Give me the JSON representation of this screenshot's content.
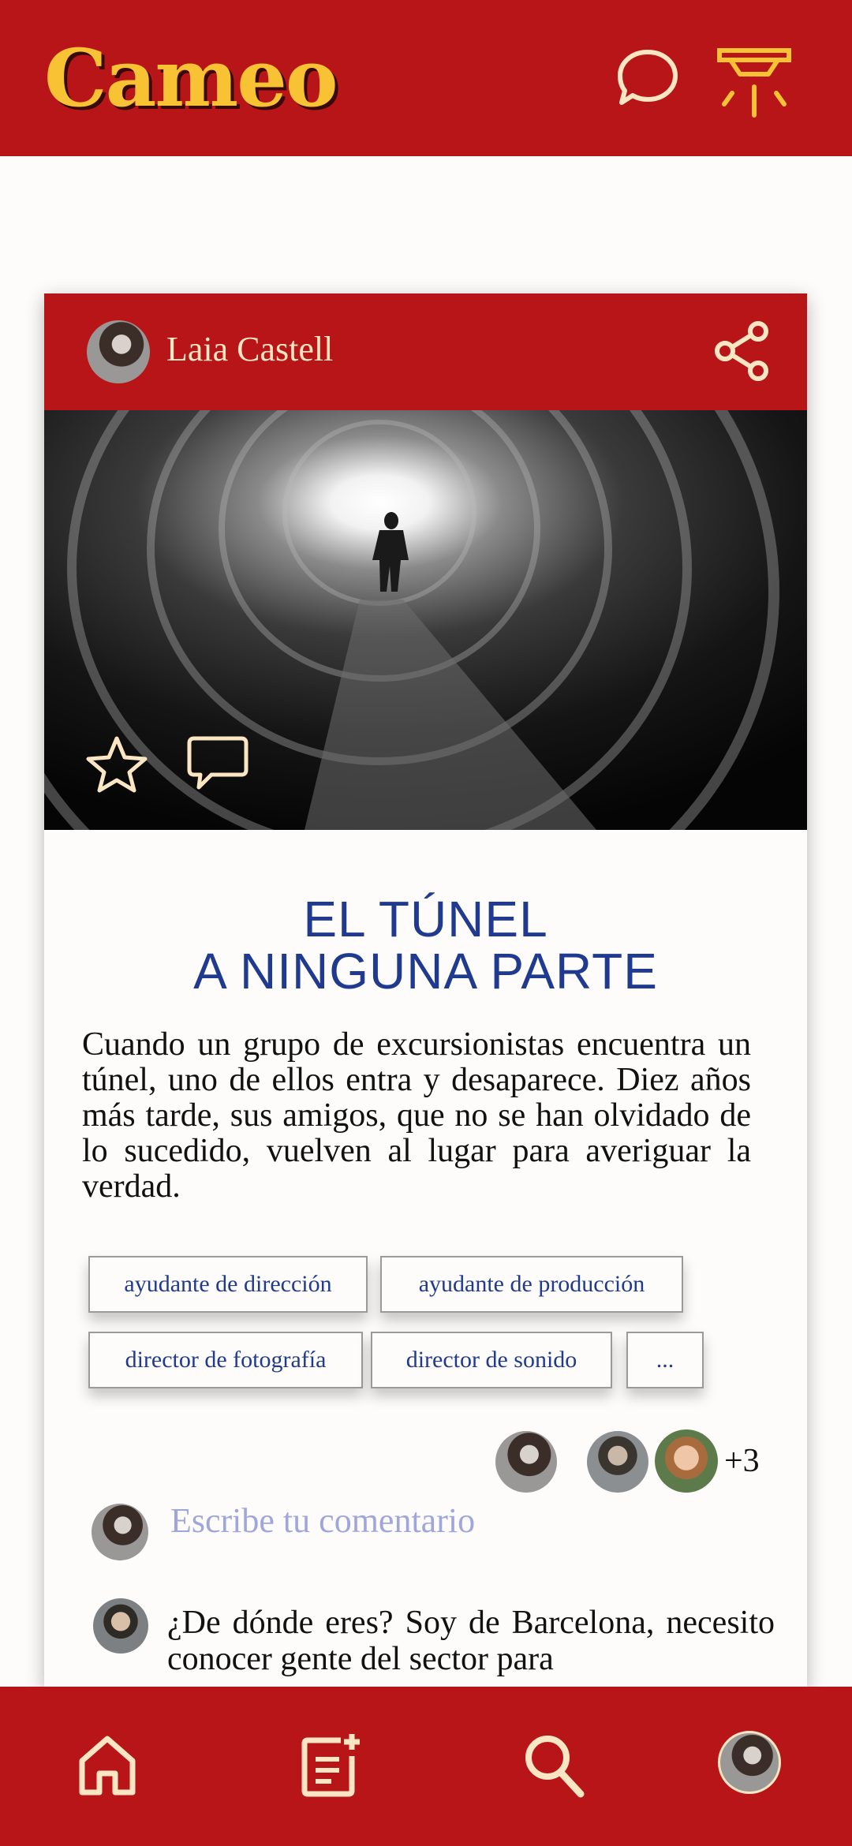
{
  "app": {
    "title": "Cameo"
  },
  "header": {
    "icons": [
      "chat-bubble-icon",
      "spotlight-icon"
    ]
  },
  "post": {
    "author": "Laia Castell",
    "title_line1": "EL TÚNEL",
    "title_line2": "A NINGUNA PARTE",
    "synopsis": "Cuando un grupo de excursionistas encuentra un túnel, uno de ellos entra y desaparece. Diez años más tarde, sus amigos, que no se han olvidado de lo sucedido, vuelven al lugar para averiguar la verdad.",
    "tags": [
      "ayudante de dirección",
      "ayudante de producción",
      "director de fotografía",
      "director de sonido",
      "..."
    ],
    "participants_more": "+3"
  },
  "comments": {
    "placeholder": "Escribe tu comentario",
    "items": [
      {
        "text": "¿De dónde eres? Soy de Barcelona, necesito conocer gente del sector para"
      }
    ]
  },
  "bottom_nav": [
    "home-icon",
    "new-post-icon",
    "search-icon",
    "profile-avatar"
  ],
  "colors": {
    "brand_red": "#b81519",
    "logo_yellow": "#f7c234",
    "cream": "#fbe6c4",
    "title_blue": "#1f3a8f",
    "placeholder": "#9fa6dc"
  }
}
